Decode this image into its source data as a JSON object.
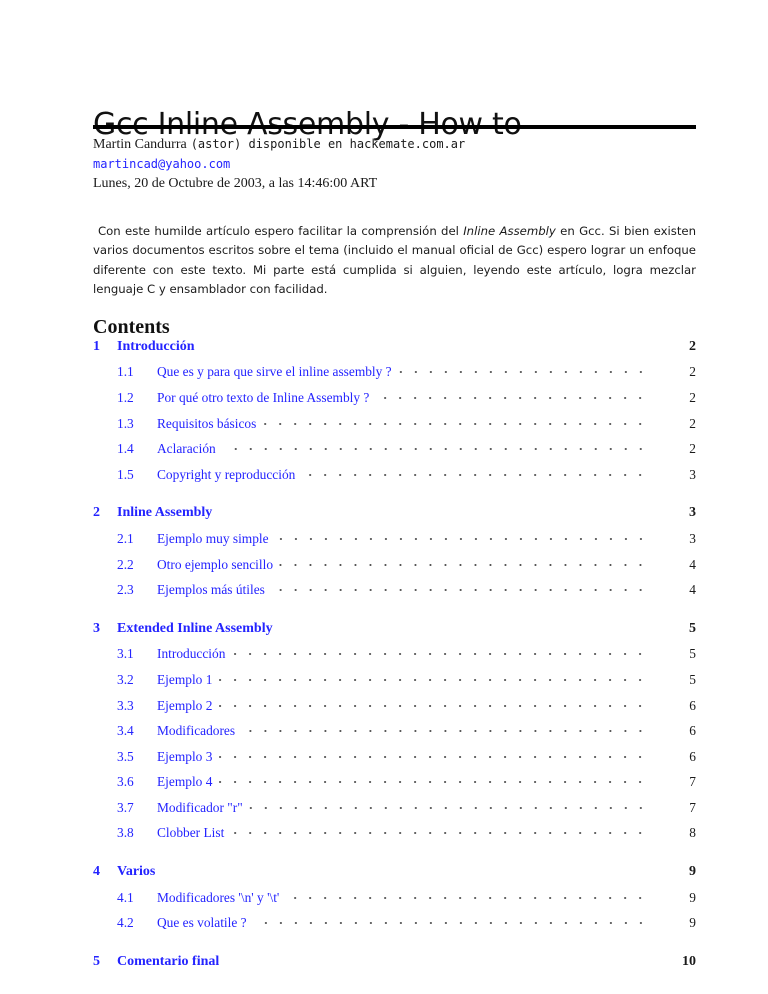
{
  "document": {
    "title": "Gcc Inline Assembly - How to",
    "author_line": {
      "name": "Martin Candurra",
      "mono_text": "(astor) disponible en hackemate.com.ar"
    },
    "email": "martincad@yahoo.com",
    "date": "Lunes, 20 de Octubre de 2003, a las 14:46:00 ART",
    "abstract": {
      "part1": "Con este humilde artículo espero facilitar la comprensión del ",
      "emphasis": "Inline Assembly",
      "part2": " en Gcc.  Si bien existen varios documentos escritos sobre el tema (incluido el manual oficial de Gcc) espero lograr un enfoque diferente con este texto.  Mi parte está cumplida si alguien, leyendo este artículo, logra mezclar lenguaje C y ensamblador con facilidad."
    },
    "link_color": "#2424ff"
  },
  "toc": {
    "heading": "Contents",
    "sections": [
      {
        "num": "1",
        "title": "Introducción",
        "page": "2",
        "subsections": [
          {
            "num": "1.1",
            "title": "Que es y para que sirve el inline assembly ?",
            "page": "2"
          },
          {
            "num": "1.2",
            "title": "Por qué otro texto de Inline Assembly ?",
            "page": "2"
          },
          {
            "num": "1.3",
            "title": "Requisitos básicos",
            "page": "2"
          },
          {
            "num": "1.4",
            "title": "Aclaración",
            "page": "2"
          },
          {
            "num": "1.5",
            "title": "Copyright y reproducción",
            "page": "3"
          }
        ]
      },
      {
        "num": "2",
        "title": "Inline Assembly",
        "page": "3",
        "subsections": [
          {
            "num": "2.1",
            "title": "Ejemplo muy simple",
            "page": "3"
          },
          {
            "num": "2.2",
            "title": "Otro ejemplo sencillo",
            "page": "4"
          },
          {
            "num": "2.3",
            "title": "Ejemplos más útiles",
            "page": "4"
          }
        ]
      },
      {
        "num": "3",
        "title": "Extended Inline Assembly",
        "page": "5",
        "subsections": [
          {
            "num": "3.1",
            "title": "Introducción",
            "page": "5"
          },
          {
            "num": "3.2",
            "title": "Ejemplo 1",
            "page": "5"
          },
          {
            "num": "3.3",
            "title": "Ejemplo 2",
            "page": "6"
          },
          {
            "num": "3.4",
            "title": "Modificadores",
            "page": "6"
          },
          {
            "num": "3.5",
            "title": "Ejemplo 3",
            "page": "6"
          },
          {
            "num": "3.6",
            "title": "Ejemplo 4",
            "page": "7"
          },
          {
            "num": "3.7",
            "title": "Modificador \"r\"",
            "page": "7"
          },
          {
            "num": "3.8",
            "title": "Clobber List",
            "page": "8"
          }
        ]
      },
      {
        "num": "4",
        "title": "Varios",
        "page": "9",
        "subsections": [
          {
            "num": "4.1",
            "title": "Modificadores '\\n' y '\\t'",
            "page": "9"
          },
          {
            "num": "4.2",
            "title": "Que es volatile ?",
            "page": "9"
          }
        ]
      },
      {
        "num": "5",
        "title": "Comentario final",
        "page": "10",
        "subsections": []
      }
    ]
  }
}
